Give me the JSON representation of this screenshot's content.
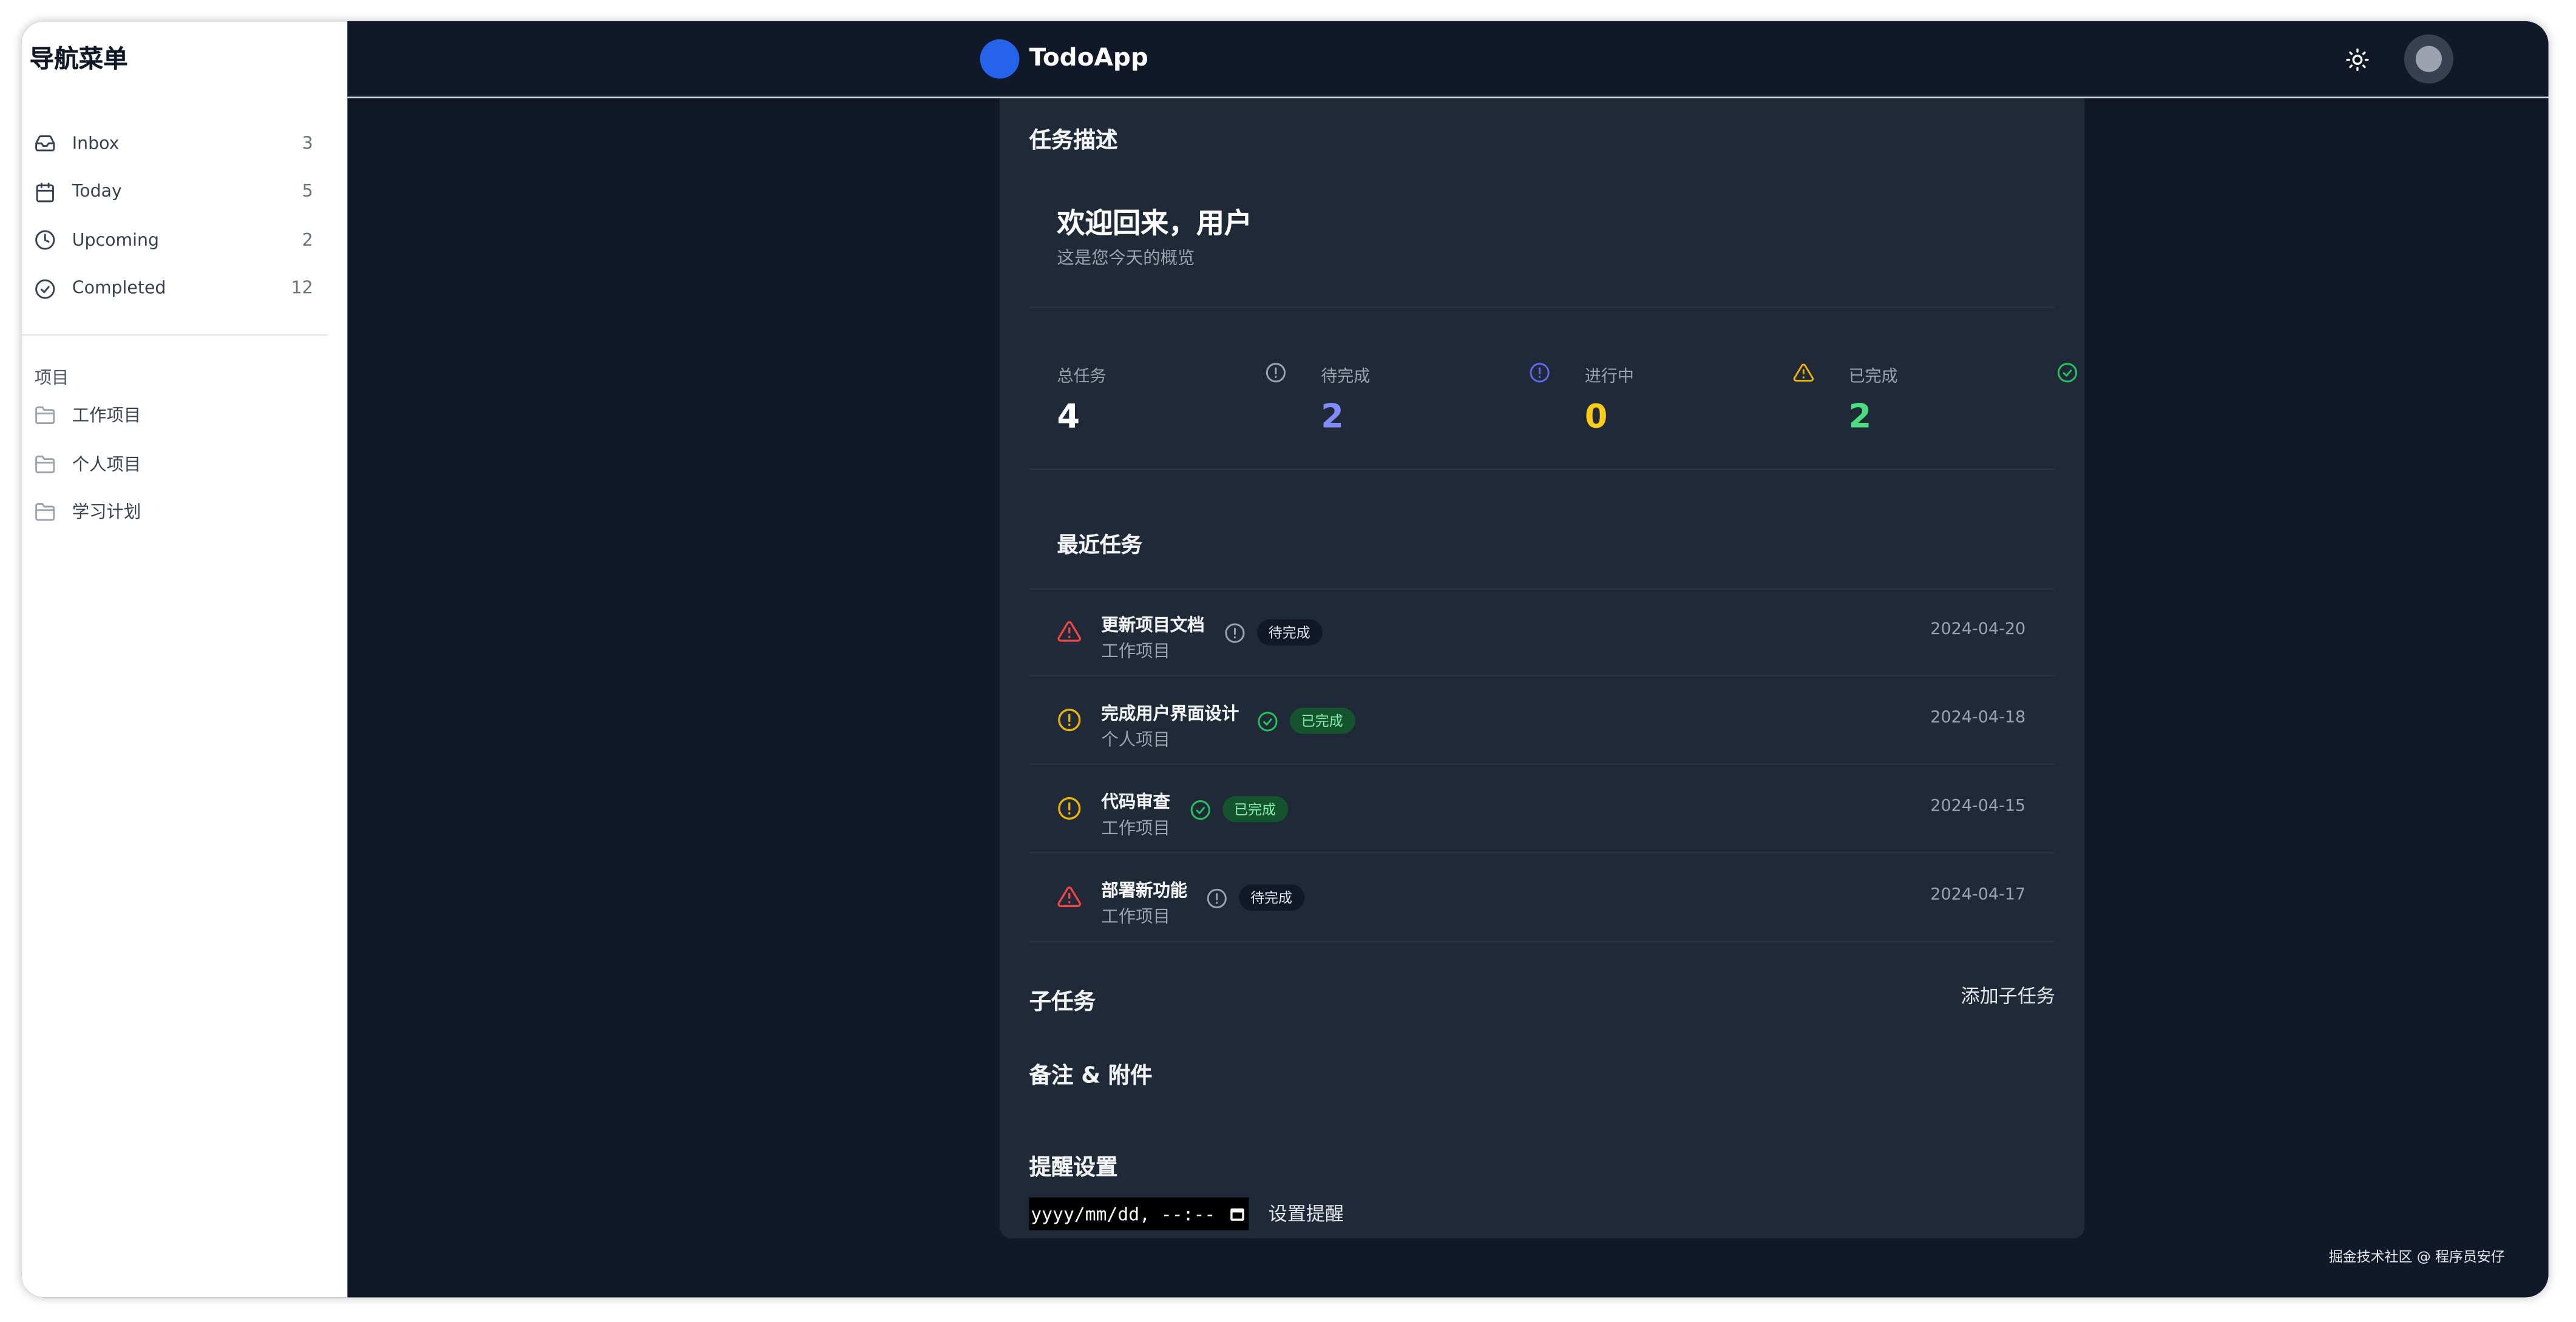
{
  "sidebar": {
    "title": "导航菜单",
    "nav_items": [
      {
        "label": "Inbox",
        "count": "3",
        "icon": "inbox-icon"
      },
      {
        "label": "Today",
        "count": "5",
        "icon": "calendar-icon"
      },
      {
        "label": "Upcoming",
        "count": "2",
        "icon": "clock-icon"
      },
      {
        "label": "Completed",
        "count": "12",
        "icon": "check-circle-icon"
      }
    ],
    "projects_heading": "项目",
    "projects": [
      {
        "label": "工作项目",
        "icon": "folder-icon"
      },
      {
        "label": "个人项目",
        "icon": "folder-icon"
      },
      {
        "label": "学习计划",
        "icon": "folder-icon"
      }
    ]
  },
  "header": {
    "app_name": "TodoApp",
    "theme_icon": "sun-icon",
    "brand_color": "#2563eb"
  },
  "detail": {
    "section_description": "任务描述",
    "welcome_title": "欢迎回来，用户",
    "welcome_subtitle": "这是您今天的概览",
    "stats": [
      {
        "label": "总任务",
        "value": "4",
        "color": "#ffffff",
        "icon": "info-circle-icon",
        "icon_color": "#9ca3af"
      },
      {
        "label": "待完成",
        "value": "2",
        "color": "#818cf8",
        "icon": "info-circle-icon",
        "icon_color": "#6366f1"
      },
      {
        "label": "进行中",
        "value": "0",
        "color": "#facc15",
        "icon": "warning-triangle-icon",
        "icon_color": "#eab308"
      },
      {
        "label": "已完成",
        "value": "2",
        "color": "#4ade80",
        "icon": "check-circle-icon",
        "icon_color": "#22c55e"
      }
    ],
    "recent_title": "最近任务",
    "tasks": [
      {
        "name": "更新项目文档",
        "project": "工作项目",
        "status": "待完成",
        "status_type": "pending",
        "priority": "high",
        "date": "2024-04-20"
      },
      {
        "name": "完成用户界面设计",
        "project": "个人项目",
        "status": "已完成",
        "status_type": "done",
        "priority": "medium",
        "date": "2024-04-18"
      },
      {
        "name": "代码审查",
        "project": "工作项目",
        "status": "已完成",
        "status_type": "done",
        "priority": "medium",
        "date": "2024-04-15"
      },
      {
        "name": "部署新功能",
        "project": "工作项目",
        "status": "待完成",
        "status_type": "pending",
        "priority": "high",
        "date": "2024-04-17"
      }
    ],
    "subtasks_title": "子任务",
    "add_subtask_label": "添加子任务",
    "notes_title": "备注 & 附件",
    "reminder_title": "提醒设置",
    "reminder_input_value": "yyyy/mm/dd, --:--",
    "set_reminder_label": "设置提醒"
  },
  "watermark": "掘金技术社区 @ 程序员安仔"
}
